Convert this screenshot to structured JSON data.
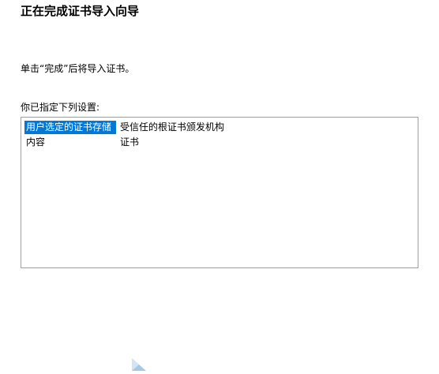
{
  "wizard": {
    "title": "正在完成证书导入向导",
    "instruction": "单击“完成”后将导入证书。",
    "settings_label": "你已指定下列设置:",
    "settings": [
      {
        "key": "用户选定的证书存储",
        "value": "受信任的根证书颁发机构",
        "selected": true
      },
      {
        "key": "内容",
        "value": "证书",
        "selected": false
      }
    ]
  },
  "colors": {
    "selection": "#0078d7",
    "list_border": "#a0a0a0",
    "corner_mark": "#a8c8e8"
  },
  "icons": {
    "corner_mark": "triangle-corner-icon"
  }
}
